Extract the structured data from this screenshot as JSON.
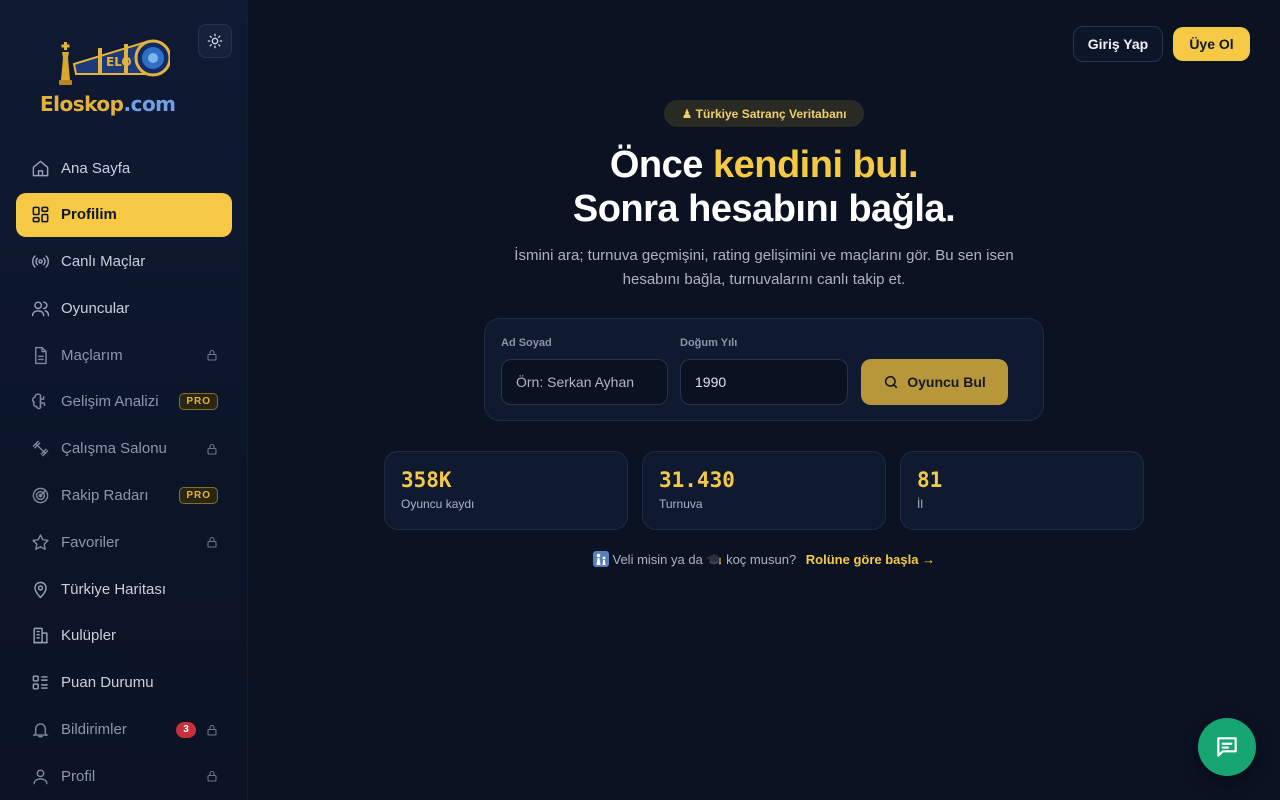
{
  "brand": {
    "name_main": "Eloskop",
    "name_tld": ".com",
    "logo_word": "ELO"
  },
  "sidebar": {
    "items": [
      {
        "label": "Ana Sayfa",
        "icon": "home-icon"
      },
      {
        "label": "Profilim",
        "icon": "dashboard-icon",
        "active": true
      },
      {
        "label": "Canlı Maçlar",
        "icon": "broadcast-icon"
      },
      {
        "label": "Oyuncular",
        "icon": "users-icon"
      },
      {
        "label": "Maçlarım",
        "icon": "document-icon",
        "locked": true
      },
      {
        "label": "Gelişim Analizi",
        "icon": "brain-icon",
        "badge": "PRO"
      },
      {
        "label": "Çalışma Salonu",
        "icon": "dumbbell-icon",
        "locked": true
      },
      {
        "label": "Rakip Radarı",
        "icon": "radar-icon",
        "badge": "PRO"
      },
      {
        "label": "Favoriler",
        "icon": "star-icon",
        "locked": true
      },
      {
        "label": "Türkiye Haritası",
        "icon": "map-pin-icon"
      },
      {
        "label": "Kulüpler",
        "icon": "building-icon"
      },
      {
        "label": "Puan Durumu",
        "icon": "list-icon"
      },
      {
        "label": "Bildirimler",
        "icon": "bell-icon",
        "count": "3",
        "locked": true
      },
      {
        "label": "Profil",
        "icon": "user-icon",
        "locked": true
      }
    ]
  },
  "header": {
    "login_label": "Giriş Yap",
    "signup_label": "Üye Ol"
  },
  "hero": {
    "pill": "♟ Türkiye Satranç Veritabanı",
    "title_line1_pre": "Önce ",
    "title_line1_hl": "kendini bul.",
    "title_line2": "Sonra hesabını bağla.",
    "subtitle": "İsmini ara; turnuva geçmişini, rating gelişimini ve maçlarını gör. Bu sen isen hesabını bağla, turnuvalarını canlı takip et."
  },
  "search": {
    "name_label": "Ad Soyad",
    "name_placeholder": "Örn: Serkan Ayhan",
    "year_label": "Doğum Yılı",
    "year_value": "1990",
    "button_label": "Oyuncu Bul"
  },
  "stats": [
    {
      "value": "358K",
      "label": "Oyuncu kaydı"
    },
    {
      "value": "31.430",
      "label": "Turnuva"
    },
    {
      "value": "81",
      "label": "İl"
    }
  ],
  "role": {
    "text_a": "Veli misin ya da",
    "text_b": "koç musun?",
    "link": "Rolüne göre başla →"
  },
  "colors": {
    "accent": "#f6c945",
    "background": "#0b1222",
    "chat": "#17a673"
  }
}
